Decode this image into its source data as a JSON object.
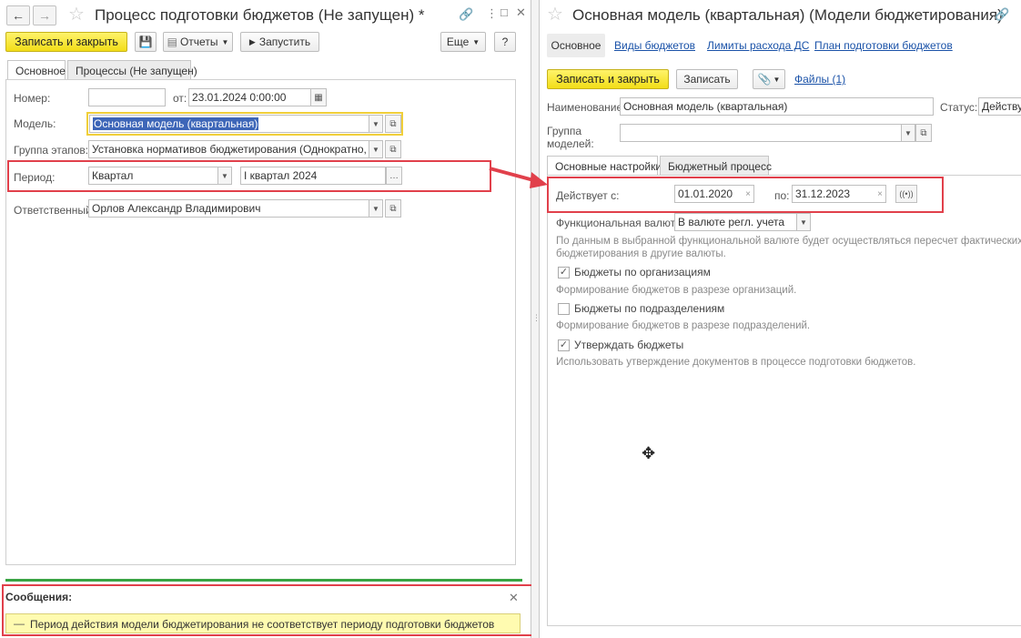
{
  "left": {
    "title": "Процесс подготовки бюджетов (Не запущен) *",
    "toolbar": {
      "save_close": "Записать и закрыть",
      "reports": "Отчеты",
      "run": "Запустить",
      "more": "Еще",
      "help": "?"
    },
    "tabs": [
      "Основное",
      "Процессы (Не запущен)"
    ],
    "form": {
      "number_label": "Номер:",
      "number_value": "",
      "from_label": "от:",
      "date_value": "23.01.2024  0:00:00",
      "model_label": "Модель:",
      "model_value": "Основная модель (квартальная)",
      "stage_group_label": "Группа этапов:",
      "stage_group_value": "Установка нормативов бюджетирования (Однократно, Парал",
      "period_label": "Период:",
      "period_type": "Квартал",
      "period_value": "I квартал 2024",
      "responsible_label": "Ответственный:",
      "responsible_value": "Орлов Александр Владимирович"
    },
    "messages": {
      "header": "Сообщения:",
      "text": "Период действия модели бюджетирования не соответствует периоду подготовки бюджетов"
    }
  },
  "right": {
    "title": "Основная модель (квартальная) (Модели бюджетирования)",
    "nav_tabs": [
      "Основное",
      "Виды  бюджетов",
      "Лимиты расхода ДС",
      "План подготовки бюджетов"
    ],
    "toolbar": {
      "save_close": "Записать и закрыть",
      "save": "Записать",
      "files": "Файлы (1)"
    },
    "form": {
      "name_label": "Наименование:",
      "name_value": "Основная модель (квартальная)",
      "status_label": "Статус:",
      "status_value": "Действует",
      "group_label_1": "Группа",
      "group_label_2": "моделей:",
      "group_value": ""
    },
    "tabs": [
      "Основные настройки",
      "Бюджетный процесс"
    ],
    "settings": {
      "valid_from_label": "Действует с:",
      "valid_from": "01.01.2020",
      "to_label": "по:",
      "valid_to": "31.12.2023",
      "currency_label": "Функциональная валюта:",
      "currency_value": "В валюте регл. учета",
      "currency_hint_1": "По данным в выбранной функциональной валюте будет осуществляться пересчет фактических данных",
      "currency_hint_2": "бюджетирования в другие валюты.",
      "cb_orgs": "Бюджеты по организациям",
      "cb_orgs_hint": "Формирование бюджетов в разрезе организаций.",
      "cb_depts": "Бюджеты по подразделениям",
      "cb_depts_hint": "Формирование бюджетов в разрезе подразделений.",
      "cb_approve": "Утверждать бюджеты",
      "cb_approve_hint": "Использовать утверждение документов в процессе подготовки бюджетов."
    },
    "checkboxes": {
      "orgs": true,
      "depts": false,
      "approve": true
    }
  },
  "colors": {
    "accent_yellow": "#f5e21c",
    "highlight_red": "#e1404b",
    "link_blue": "#1a52a8"
  }
}
